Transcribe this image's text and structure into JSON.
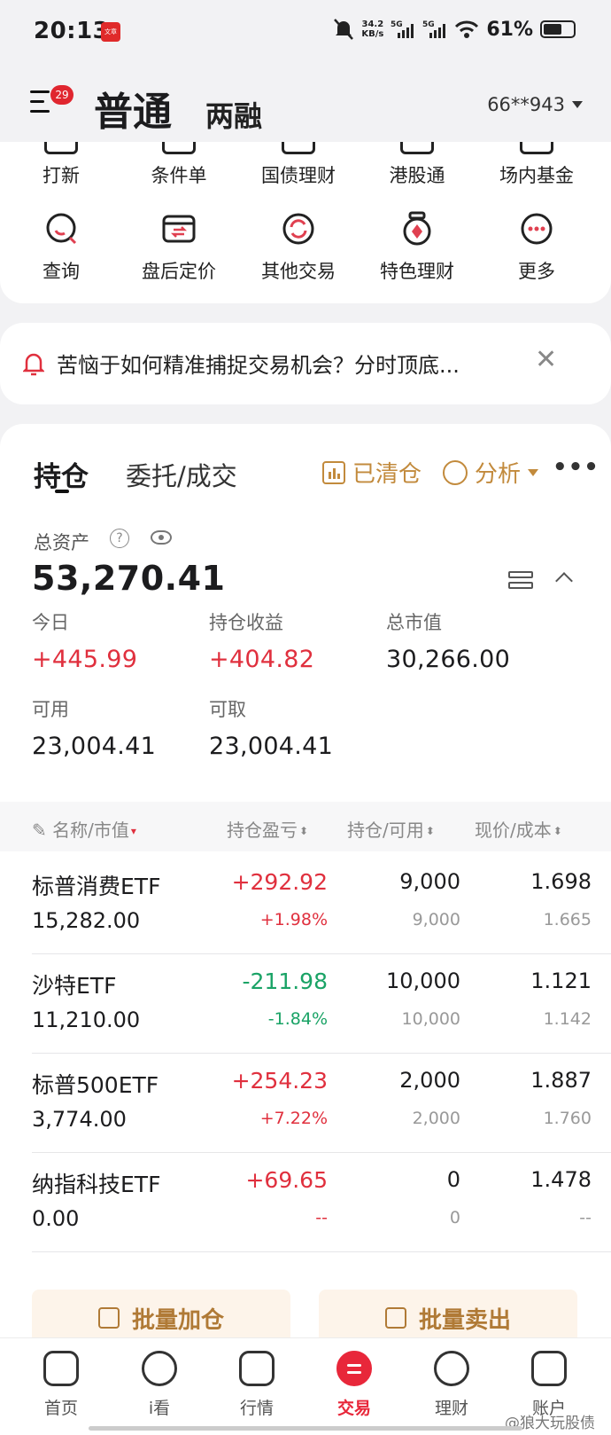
{
  "status_bar": {
    "time": "20:13",
    "app_badge": "文章",
    "net_speed": "34.2",
    "net_unit": "KB/s",
    "signal1": "5G",
    "signal2": "5G",
    "battery": "61%",
    "battery_level": 0.61
  },
  "header": {
    "menu_badge": "29",
    "tab_active": "普通",
    "tab_other": "两融",
    "account": "66**943"
  },
  "quick_grid": {
    "row1": [
      "打新",
      "条件单",
      "国债理财",
      "港股通",
      "场内基金"
    ],
    "row2": [
      {
        "label": "查询",
        "icon": "search-icon"
      },
      {
        "label": "盘后定价",
        "icon": "exchange-box-icon"
      },
      {
        "label": "其他交易",
        "icon": "refresh-circle-icon"
      },
      {
        "label": "特色理财",
        "icon": "medal-icon"
      },
      {
        "label": "更多",
        "icon": "more-circle-icon"
      }
    ]
  },
  "notice": {
    "text": "苦恼于如何精准捕捉交易机会？分时顶底...",
    "close": "✕"
  },
  "positions": {
    "tab_holdings": "持仓",
    "tab_orders": "委托/成交",
    "cleared": "已清仓",
    "analysis": "分析",
    "more": "•••",
    "total_assets_label": "总资产",
    "total_assets": "53,270.41",
    "stats": {
      "today_label": "今日",
      "today": "+445.99",
      "pnl_label": "持仓收益",
      "pnl": "+404.82",
      "mkt_label": "总市值",
      "mkt": "30,266.00",
      "avail_label": "可用",
      "avail": "23,004.41",
      "withdraw_label": "可取",
      "withdraw": "23,004.41"
    },
    "columns": [
      "名称/市值",
      "持仓盈亏",
      "持仓/可用",
      "现价/成本"
    ],
    "rows": [
      {
        "name": "标普消费ETF",
        "mv": "15,282.00",
        "pl": "+292.92",
        "plp": "+1.98%",
        "pos": "9,000",
        "avl": "9,000",
        "price": "1.698",
        "cost": "1.665",
        "trend": "up"
      },
      {
        "name": "沙特ETF",
        "mv": "11,210.00",
        "pl": "-211.98",
        "plp": "-1.84%",
        "pos": "10,000",
        "avl": "10,000",
        "price": "1.121",
        "cost": "1.142",
        "trend": "down"
      },
      {
        "name": "标普500ETF",
        "mv": "3,774.00",
        "pl": "+254.23",
        "plp": "+7.22%",
        "pos": "2,000",
        "avl": "2,000",
        "price": "1.887",
        "cost": "1.760",
        "trend": "up"
      },
      {
        "name": "纳指科技ETF",
        "mv": "0.00",
        "pl": "+69.65",
        "plp": "--",
        "pos": "0",
        "avl": "0",
        "price": "1.478",
        "cost": "--",
        "trend": "up"
      }
    ],
    "batch_add": "批量加仓",
    "batch_sell": "批量卖出"
  },
  "bottom_nav": [
    "首页",
    "i看",
    "行情",
    "交易",
    "理财",
    "账户"
  ],
  "watermark": "@狼大玩股债",
  "colors": {
    "up": "#e0303e",
    "down": "#1aa366",
    "accent_gold": "#c28a3c",
    "active_tab": "#e8273a"
  }
}
